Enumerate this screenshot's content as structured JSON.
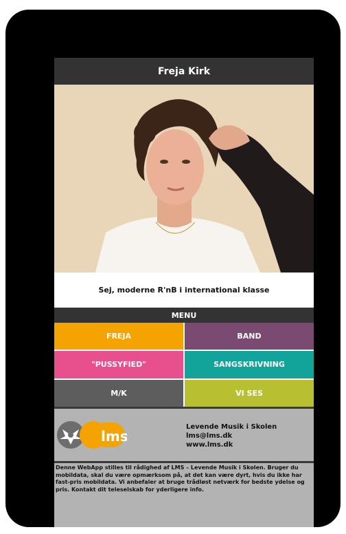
{
  "app": {
    "title": "Freja Kirk"
  },
  "hero": {
    "tagline": "Sej, moderne R'nB i international klasse"
  },
  "menu": {
    "header": "MENU",
    "items": [
      {
        "label": "FREJA",
        "color": "#f5a300"
      },
      {
        "label": "BAND",
        "color": "#7b4a72"
      },
      {
        "label": "\"PUSSYFIED\"",
        "color": "#e8508d"
      },
      {
        "label": "SANGSKRIVNING",
        "color": "#12a39a"
      },
      {
        "label": "M/K",
        "color": "#5d5d5d"
      },
      {
        "label": "VI SES",
        "color": "#b8c031"
      }
    ]
  },
  "footer": {
    "logo_text": "LMS",
    "contact": {
      "name": "Levende Musik i Skolen",
      "email": "lms@lms.dk",
      "website": "www.lms.dk"
    },
    "disclaimer": "Denne WebApp stilles til rådighed af LMS – Levende Musik i Skolen. Bruger du mobildata, skal du være opmærksom på, at det kan være dyrt, hvis du ikke har fast-pris mobildata. Vi anbefaler at bruge trådløst netværk for bedste ydelse og pris. Kontakt dit teleselskab for yderligere info."
  },
  "colors": {
    "bar": "#333333",
    "footer_bg": "#b3b3b3",
    "logo_orange": "#f5a300",
    "logo_gray": "#6d6d6d"
  }
}
